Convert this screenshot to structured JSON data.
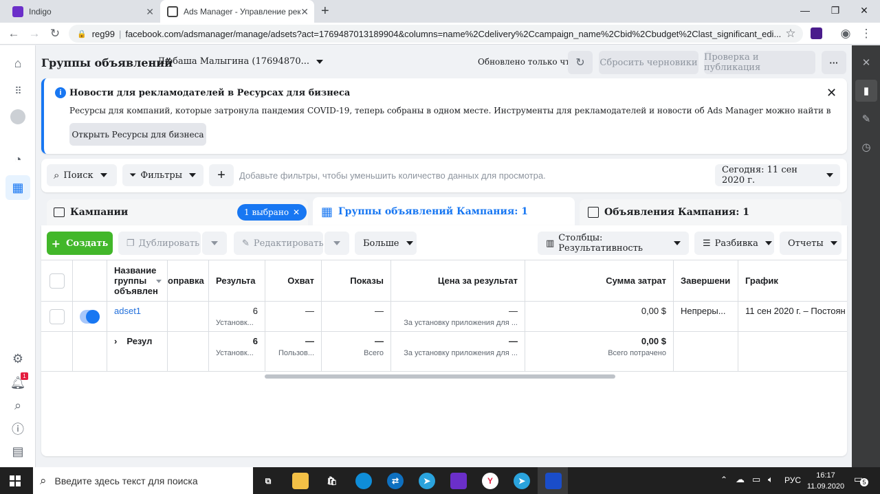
{
  "browser": {
    "tabs": [
      {
        "title": "Indigo",
        "favicon_color": "#6b2fc9"
      },
      {
        "title": "Ads Manager - Управление рекл",
        "favicon_color": "#444444"
      }
    ],
    "new_tab": "+",
    "url_host": "reg99",
    "url": "facebook.com/adsmanager/manage/adsets?act=1769487013189904&columns=name%2Cdelivery%2Ccampaign_name%2Cbid%2Cbudget%2Clast_significant_edi...",
    "profile_badge_color": "#4a1c8c"
  },
  "header": {
    "title": "Группы объявлений",
    "account": "Любаша Малыгина (17694870...",
    "updated": "Обновлено только что",
    "discard_label": "Сбросить черновики",
    "publish_label": "Проверка и публикация",
    "more": "···"
  },
  "notice": {
    "title": "Новости для рекламодателей в Ресурсах для бизнеса",
    "body": "Ресурсы для компаний, которые затронула пандемия COVID-19, теперь собраны в одном месте. Инструменты для рекламодателей и новости об Ads Manager можно найти в Ресурсах для бизнеса.",
    "button": "Открыть Ресурсы для бизнеса",
    "close": "✕"
  },
  "filters": {
    "search": "Поиск",
    "filters": "Фильтры",
    "add": "+",
    "placeholder": "Добавьте фильтры, чтобы уменьшить количество данных для просмотра.",
    "date": "Сегодня: 11 сен 2020 г."
  },
  "tabs": {
    "campaigns": "Кампании",
    "selected_badge": "1 выбрано",
    "adsets": "Группы объявлений Кампания: 1",
    "ads": "Объявления Кампания: 1"
  },
  "toolbar": {
    "create": "Создать",
    "duplicate": "Дублировать",
    "edit": "Редактировать",
    "more": "Больше",
    "columns": "Столбцы: Результативность",
    "breakdown": "Разбивка",
    "reports": "Отчеты"
  },
  "table": {
    "headers": {
      "name": "Название группы объявлен",
      "delivery": "оправка",
      "results": "Результа",
      "reach": "Охват",
      "impressions": "Показы",
      "cost_per_result": "Цена за результат",
      "amount_spent": "Сумма затрат",
      "ends": "Завершени",
      "schedule": "График"
    },
    "row": {
      "name": "adset1",
      "results": "6",
      "results_sub": "Установк...",
      "reach": "—",
      "impressions": "—",
      "cost": "—",
      "cost_sub": "За установку приложения для ...",
      "spent": "0,00 $",
      "ends": "Непреры...",
      "schedule": "11 сен 2020 г. – Постоян"
    },
    "totals": {
      "label": "Резул",
      "results": "6",
      "results_sub": "Установк...",
      "reach": "—",
      "reach_sub": "Пользов...",
      "impressions": "—",
      "impressions_sub": "Всего",
      "cost": "—",
      "cost_sub": "За установку приложения для ...",
      "spent": "0,00 $",
      "spent_sub": "Всего потрачено"
    }
  },
  "rail": {
    "notification_count": "1"
  },
  "taskbar": {
    "search_placeholder": "Введите здесь текст для поиска",
    "lang": "РУС",
    "time": "16:17",
    "date": "11.09.2020",
    "notif_count": "5"
  }
}
